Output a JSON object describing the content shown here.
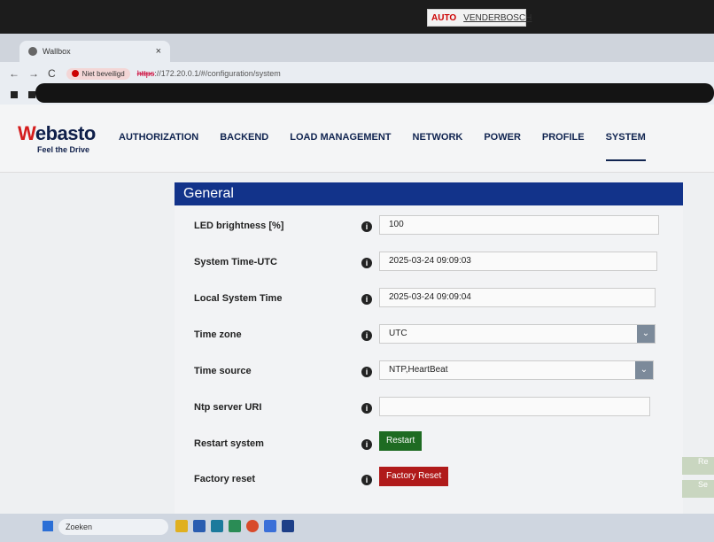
{
  "sticker": {
    "brand": "AUTO",
    "name": "VENDERBOSCH"
  },
  "browser": {
    "tab_title": "Wallbox",
    "tab_close": "×",
    "new_tab": "+",
    "nav_back": "←",
    "nav_forward": "→",
    "nav_reload": "C",
    "security_label": "Niet beveiligd",
    "url_scheme": "https",
    "url_rest": "://172.20.0.1/#/configuration/system"
  },
  "header": {
    "brand_name": "ebasto",
    "brand_mark": "W",
    "tagline": "Feel the Drive",
    "menu": [
      {
        "label": "AUTHORIZATION"
      },
      {
        "label": "BACKEND"
      },
      {
        "label": "LOAD MANAGEMENT"
      },
      {
        "label": "NETWORK"
      },
      {
        "label": "POWER"
      },
      {
        "label": "PROFILE"
      },
      {
        "label": "SYSTEM",
        "active": true
      }
    ]
  },
  "panel": {
    "title": "General",
    "rows": [
      {
        "label": "LED brightness [%]",
        "value": "100",
        "type": "input"
      },
      {
        "label": "System Time-UTC",
        "value": "2025-03-24 09:09:03",
        "type": "input"
      },
      {
        "label": "Local System Time",
        "value": "2025-03-24 09:09:04",
        "type": "input"
      },
      {
        "label": "Time zone",
        "value": "UTC",
        "type": "select"
      },
      {
        "label": "Time source",
        "value": "NTP,HeartBeat",
        "type": "select"
      },
      {
        "label": "Ntp server URI",
        "value": "",
        "type": "input"
      },
      {
        "label": "Restart system",
        "button": "Restart",
        "type": "button-green"
      },
      {
        "label": "Factory reset",
        "button": "Factory Reset",
        "type": "button-red"
      }
    ],
    "info_glyph": "i"
  },
  "side_buttons": [
    "Re",
    "Se"
  ],
  "taskbar": {
    "search_placeholder": "Zoeken"
  },
  "colors": {
    "panel_header": "#12338a",
    "restart_button": "#1e6b22",
    "factory_reset_button": "#b01a1a",
    "brand_navy": "#0f1f4a",
    "brand_red": "#d41d1d"
  }
}
